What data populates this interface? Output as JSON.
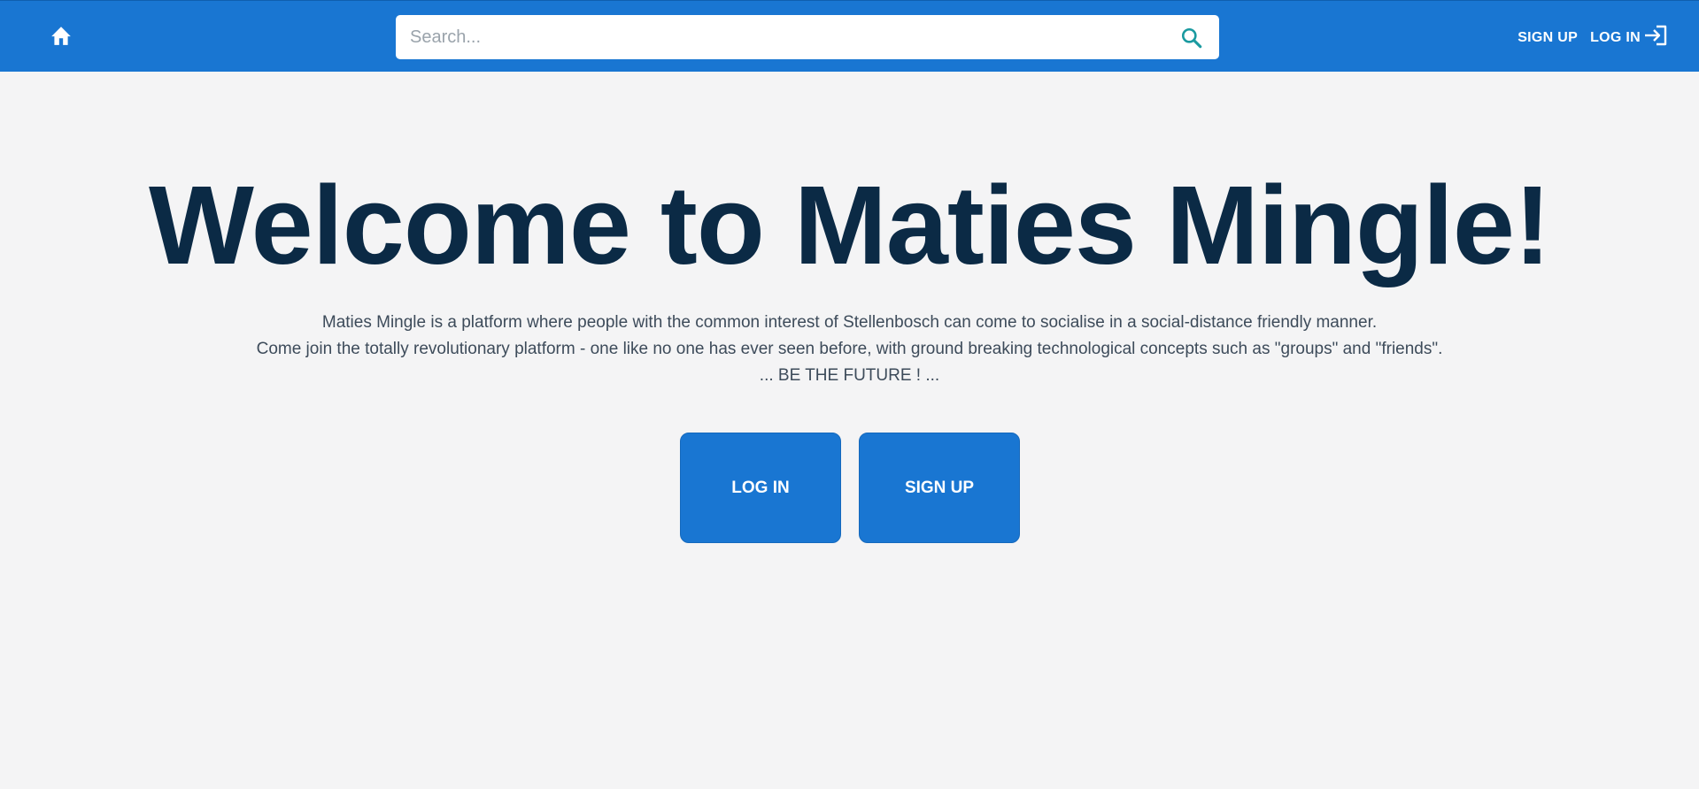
{
  "navbar": {
    "home_icon": "home-icon",
    "search": {
      "placeholder": "Search...",
      "value": "",
      "icon": "search-icon"
    },
    "signup_label": "SIGN UP",
    "login_label": "LOG IN",
    "login_icon": "login-arrow-icon"
  },
  "hero": {
    "title": "Welcome to Maties Mingle!",
    "desc_line1": "Maties Mingle is a platform where people with the common interest of Stellenbosch can come to socialise in a social-distance friendly manner.",
    "desc_line2": "Come join the totally revolutionary platform - one like no one has ever seen before, with ground breaking technological concepts such as \"groups\" and \"friends\".",
    "desc_line3": "... BE THE FUTURE ! ..."
  },
  "cta": {
    "login_label": "LOG IN",
    "signup_label": "SIGN UP"
  },
  "colors": {
    "primary": "#1976d2",
    "background": "#f4f4f5",
    "title": "#0b2a45",
    "text": "#3d4b5a",
    "search_icon": "#1a9aa0"
  }
}
